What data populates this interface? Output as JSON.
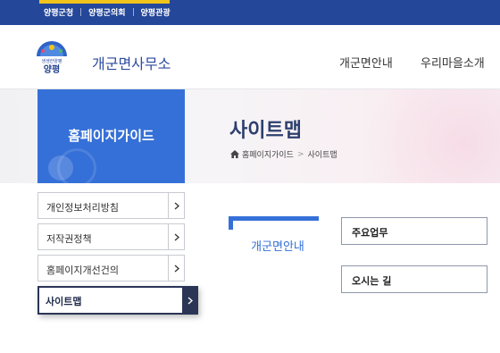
{
  "topbar": {
    "links": [
      "양평군청",
      "양평군의회",
      "양평관광"
    ]
  },
  "header": {
    "logo_small_text": "생생한양평",
    "logo_text": "양평",
    "site_name": "개군면사무소",
    "gnb": [
      "개군면안내",
      "우리마을소개"
    ]
  },
  "lnb": {
    "title": "홈페이지가이드",
    "items": [
      {
        "label": "개인정보처리방침",
        "active": false
      },
      {
        "label": "저작권정책",
        "active": false
      },
      {
        "label": "홈페이지개선건의",
        "active": false
      },
      {
        "label": "사이트맵",
        "active": true
      }
    ]
  },
  "main": {
    "page_title": "사이트맵",
    "breadcrumb": [
      "홈페이지가이드",
      "사이트맵"
    ],
    "category_label": "개군면안내",
    "sub_items": [
      "주요업무",
      "오시는 길"
    ]
  },
  "colors": {
    "topbar": "#25479a",
    "accent_yellow": "#f2c31b",
    "brand_blue": "#3570d8",
    "title_navy": "#2e3f6e",
    "active_navy": "#2b3556"
  }
}
